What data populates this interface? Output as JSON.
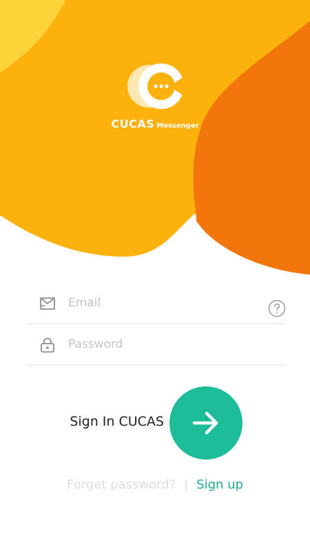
{
  "brand": {
    "name": "CUCAS",
    "subtitle": "Messenger",
    "logo_icon": "chat-bubble-c-logo"
  },
  "form": {
    "email": {
      "placeholder": "Email",
      "value": "",
      "icon": "mail-icon"
    },
    "password": {
      "placeholder": "Password",
      "value": "",
      "icon": "lock-icon"
    },
    "help_icon": "question-circle-icon"
  },
  "actions": {
    "sign_in_label": "Sign In CUCAS",
    "submit_icon": "arrow-right-icon",
    "forget_label": "Forget password?",
    "divider": "|",
    "signup_label": "Sign up"
  },
  "colors": {
    "hero_yellow": "#fdb10d",
    "hero_light_yellow": "#fdd33a",
    "hero_orange": "#f2760b",
    "accent_green": "#1ebd9a",
    "link_green": "#1ea993"
  }
}
